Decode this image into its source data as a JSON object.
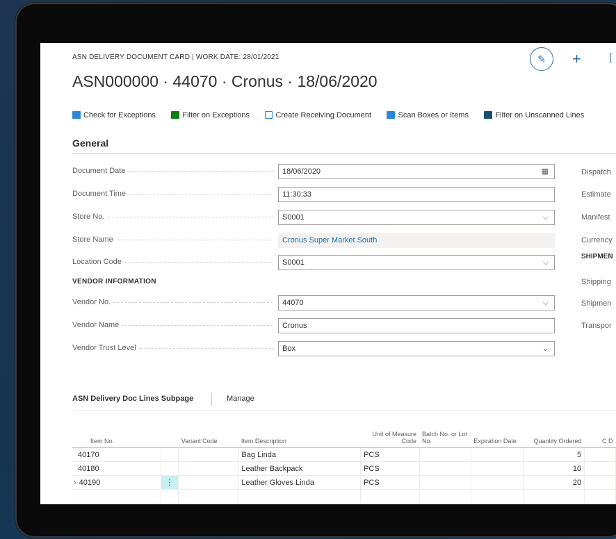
{
  "header": {
    "caption": "ASN DELIVERY DOCUMENT CARD | WORK DATE: 28/01/2021",
    "title": "ASN000000 · 44070 · Cronus · 18/06/2020",
    "back_icon": "←",
    "edit_icon": "✎",
    "plus_icon": "+",
    "more_icon": "["
  },
  "actions": [
    {
      "label": "Check for Exceptions"
    },
    {
      "label": "Filter on Exceptions"
    },
    {
      "label": "Create Receiving Document"
    },
    {
      "label": "Scan Boxes or Items"
    },
    {
      "label": "Filter on Unscanned Lines"
    }
  ],
  "general": {
    "title": "General",
    "document_date": {
      "label": "Document Date",
      "value": "18/06/2020"
    },
    "document_time": {
      "label": "Document Time",
      "value": "11:30:33"
    },
    "store_no": {
      "label": "Store No.",
      "value": "S0001"
    },
    "store_name": {
      "label": "Store Name",
      "value": "Cronus Super Market South"
    },
    "location_code": {
      "label": "Location Code",
      "value": "S0001"
    },
    "vendor_group": "VENDOR INFORMATION",
    "vendor_no": {
      "label": "Vendor No.",
      "value": "44070"
    },
    "vendor_name": {
      "label": "Vendor Name",
      "value": "Cronus"
    },
    "vendor_trust": {
      "label": "Vendor Trust Level",
      "value": "Box"
    },
    "calendar_icon": "▦",
    "chevron_icon": "⌵",
    "dropdown_icon": "⌄"
  },
  "right_column": [
    "Dispatch",
    "Estimate",
    "Manifest",
    "Currency",
    "SHIPMEN",
    "Shipping",
    "Shipmen",
    "Transpor"
  ],
  "subpage": {
    "tab": "ASN Delivery Doc Lines Subpage",
    "manage": "Manage",
    "columns": {
      "item_no": "Item No.",
      "variant": "Variant Code",
      "desc": "Item Description",
      "uom": "Unit of Measure Code",
      "batch": "Batch No. or Lot No.",
      "exp": "Expiration Date",
      "qty": "Quantity Ordered",
      "last": "C D"
    },
    "rows": [
      {
        "item_no": "40170",
        "desc": "Bag Linda",
        "uom": "PCS",
        "qty": "5"
      },
      {
        "item_no": "40180",
        "desc": "Leather Backpack",
        "uom": "PCS",
        "qty": "10"
      },
      {
        "item_no": "40190",
        "desc": "Leather Gloves Linda",
        "uom": "PCS",
        "qty": "20"
      }
    ],
    "row_menu_icon": "⋮",
    "current_row_marker": "›"
  }
}
